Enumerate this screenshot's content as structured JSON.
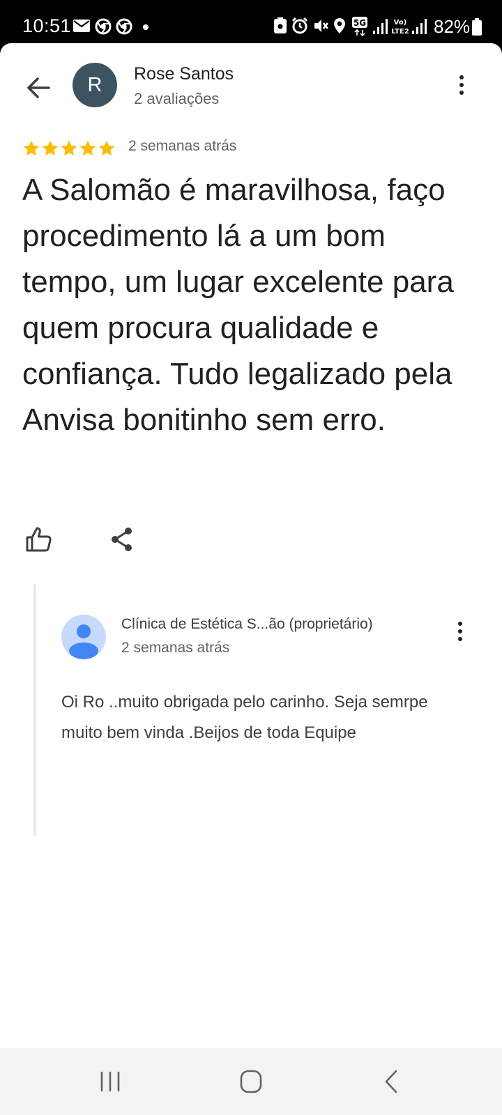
{
  "status_bar": {
    "time": "10:51",
    "battery": "82%",
    "left_icons": [
      "mail-icon",
      "chrome-icon",
      "chrome-icon",
      "dot-icon"
    ],
    "right_icons": [
      "save-icon",
      "alarm-icon",
      "mute-icon",
      "location-icon",
      "5g-icon",
      "signal-icon",
      "volte-icon",
      "signal-icon",
      "battery-icon"
    ]
  },
  "review": {
    "reviewer_initial": "R",
    "reviewer_name": "Rose Santos",
    "reviewer_meta": "2 avaliações",
    "rating": 5,
    "time": "2 semanas atrás",
    "text": "A Salomão é maravilhosa, faço procedimento lá a um bom tempo, um lugar excelente para quem procura qualidade e confiança. Tudo legalizado pela Anvisa bonitinho sem erro."
  },
  "owner_response": {
    "name": "Clínica de Estética S...ão (proprietário)",
    "time": "2 semanas atrás",
    "text": "Oi Ro ..muito obrigada pelo carinho.  Seja semrpe muito bem vinda .Beijos  de toda Equipe"
  },
  "colors": {
    "star": "#fbbc04",
    "avatar_bg": "#3c5361",
    "owner_avatar_bg": "#c6dafc",
    "owner_avatar_fg": "#4285f4",
    "primary_text": "#202124",
    "secondary_text": "#5f6368"
  }
}
